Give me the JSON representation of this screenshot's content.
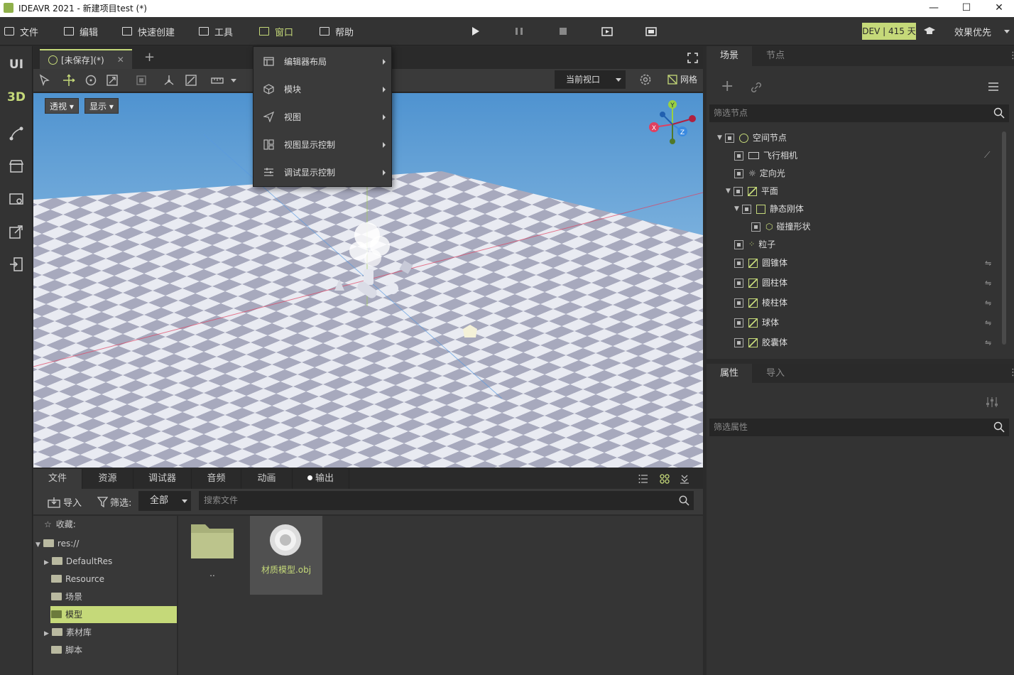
{
  "window": {
    "title": "IDEAVR 2021 - 新建项目test (*)"
  },
  "menu": {
    "file": "文件",
    "edit": "编辑",
    "quick_create": "快速创建",
    "tools": "工具",
    "window": "窗口",
    "help": "帮助"
  },
  "license": {
    "badge": "DEV | 415 天"
  },
  "quality": "效果优先",
  "side": {
    "ui": "UI",
    "three_d": "3D"
  },
  "editor_tab": {
    "label": "[未保存](*)"
  },
  "viewport_select": "当前视口",
  "grid_label": "网格",
  "viewport": {
    "perspective": "透视",
    "display": "显示"
  },
  "gizmo": {
    "x": "X",
    "y": "Y",
    "z": "Z"
  },
  "window_menu": {
    "items": [
      {
        "label": "编辑器布局"
      },
      {
        "label": "模块"
      },
      {
        "label": "视图"
      },
      {
        "label": "视图显示控制"
      },
      {
        "label": "调试显示控制"
      }
    ]
  },
  "bottom_tabs": [
    "文件",
    "资源",
    "调试器",
    "音频",
    "动画",
    "输出"
  ],
  "file_panel": {
    "import": "导入",
    "filter_label": "筛选:",
    "filter_value": "全部",
    "search_placeholder": "搜索文件",
    "favorites": "收藏:",
    "tree": [
      "res://",
      "DefaultRes",
      "Resource",
      "场景",
      "模型",
      "素材库",
      "脚本"
    ],
    "items": [
      "..",
      "材质模型.obj"
    ]
  },
  "scene_panel": {
    "tabs": [
      "场景",
      "节点"
    ],
    "filter_placeholder": "筛选节点",
    "nodes": [
      "空间节点",
      "飞行相机",
      "定向光",
      "平面",
      "静态刚体",
      "碰撞形状",
      "粒子",
      "圆锥体",
      "圆柱体",
      "棱柱体",
      "球体",
      "胶囊体"
    ]
  },
  "inspector_panel": {
    "tabs": [
      "属性",
      "导入"
    ],
    "filter_placeholder": "筛选属性"
  },
  "colors": {
    "accent": "#c5d979",
    "dark": "#333333"
  }
}
